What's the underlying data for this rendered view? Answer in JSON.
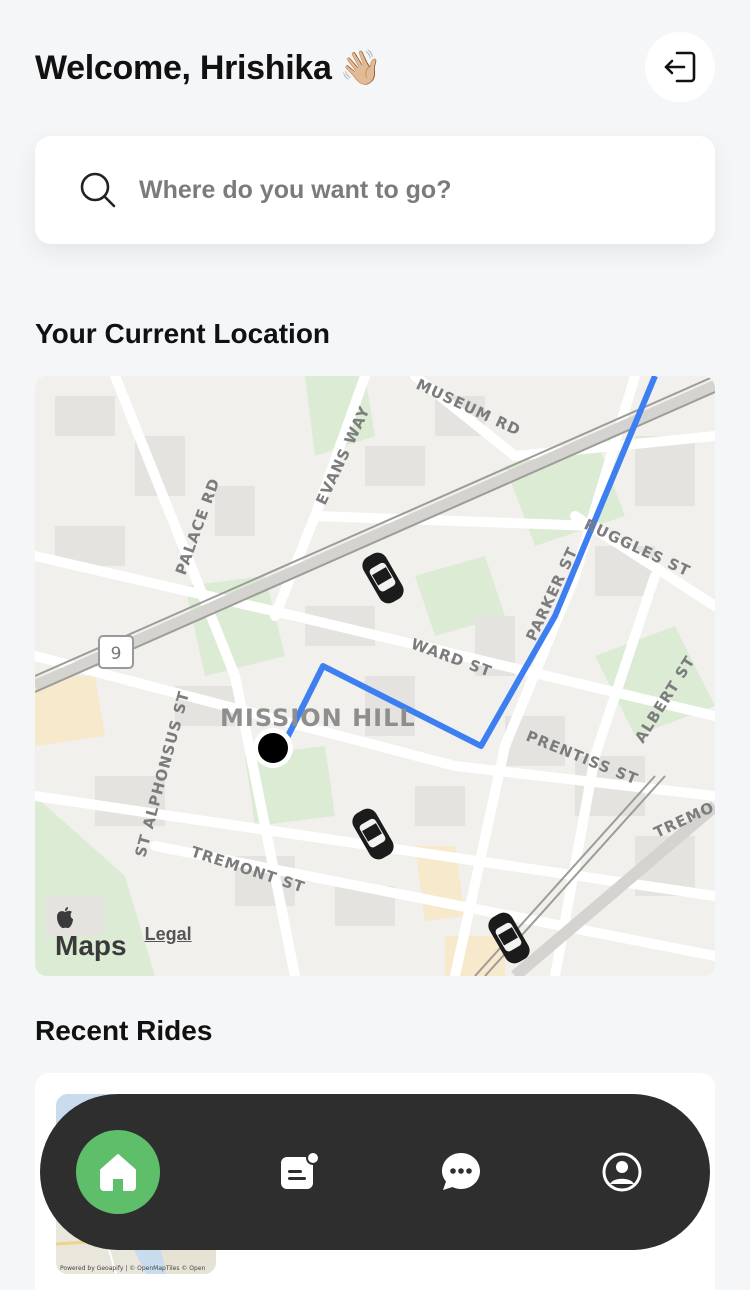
{
  "header": {
    "welcome_text": "Welcome, Hrishika",
    "wave_emoji": "👋🏼",
    "logout_icon": "logout-icon"
  },
  "search": {
    "placeholder": "Where do you want to go?",
    "icon": "search-icon"
  },
  "sections": {
    "current_location": "Your Current Location",
    "recent_rides": "Recent Rides"
  },
  "map": {
    "neighborhood": "MISSION HILL",
    "streets": [
      "MUSEUM RD",
      "EVANS WAY",
      "PALACE RD",
      "RUGGLES ST",
      "PARKER ST",
      "WARD ST",
      "ALBERT ST",
      "PRENTISS ST",
      "ST ALPHONSUS ST",
      "TREMONT ST",
      "TREMO"
    ],
    "route_shield": "9",
    "attribution_brand": "Maps",
    "attribution_legal": "Legal",
    "route_color": "#3d7ff0",
    "user_marker_color": "#000000"
  },
  "recent_ride": {
    "thumbnail_caption": "Powered by Geoapify | © OpenMapTiles © Open"
  },
  "navbar": {
    "items": [
      "home",
      "rides",
      "chat",
      "profile"
    ],
    "active": "home",
    "active_color": "#5fbe6a"
  }
}
